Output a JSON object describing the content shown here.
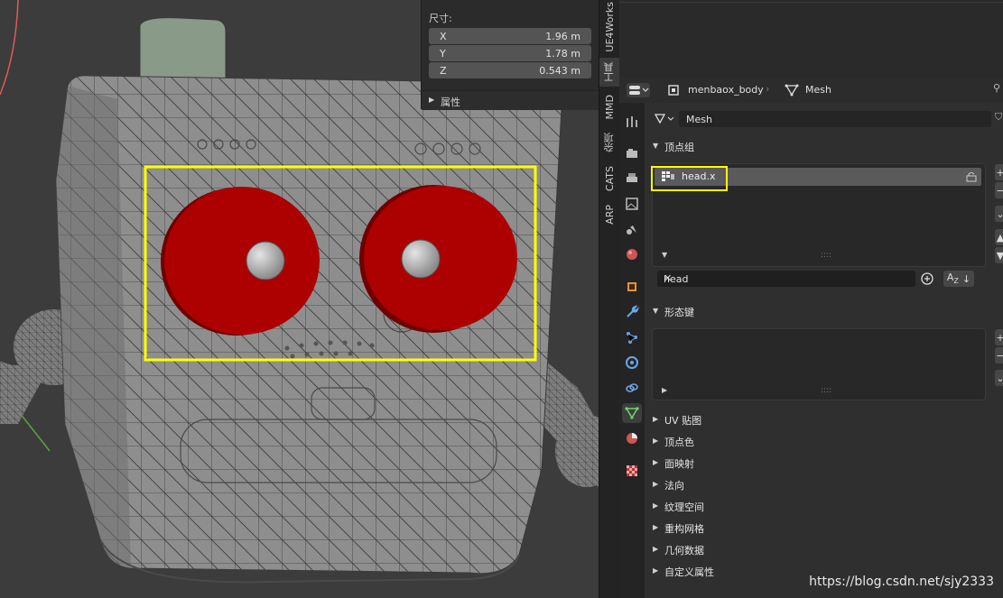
{
  "viewport": {
    "dimensions_label": "尺寸:",
    "dims": [
      {
        "axis": "X",
        "value": "1.96 m"
      },
      {
        "axis": "Y",
        "value": "1.78 m"
      },
      {
        "axis": "Z",
        "value": "0.543 m"
      }
    ],
    "properties_label": "属性"
  },
  "side_tabs": [
    "UE4Works",
    "工具",
    "MMD",
    "杂项",
    "CATS",
    "ARP"
  ],
  "header": {
    "object_name": "menbaox_body",
    "data_name": "Mesh"
  },
  "mesh_field": "Mesh",
  "panels": {
    "vertex_groups": {
      "title": "顶点组",
      "items": [
        "head.x"
      ],
      "filter_value": "head"
    },
    "shape_keys": {
      "title": "形态键"
    },
    "collapsed": [
      "UV 贴图",
      "顶点色",
      "面映射",
      "法向",
      "纹理空间",
      "重构网格",
      "几何数据",
      "自定义属性"
    ]
  },
  "colors": {
    "highlight": "#ffff00",
    "eye_red": "#aa0000",
    "accent_blue": "#5680c2"
  },
  "watermark": "https://blog.csdn.net/sjy2333"
}
